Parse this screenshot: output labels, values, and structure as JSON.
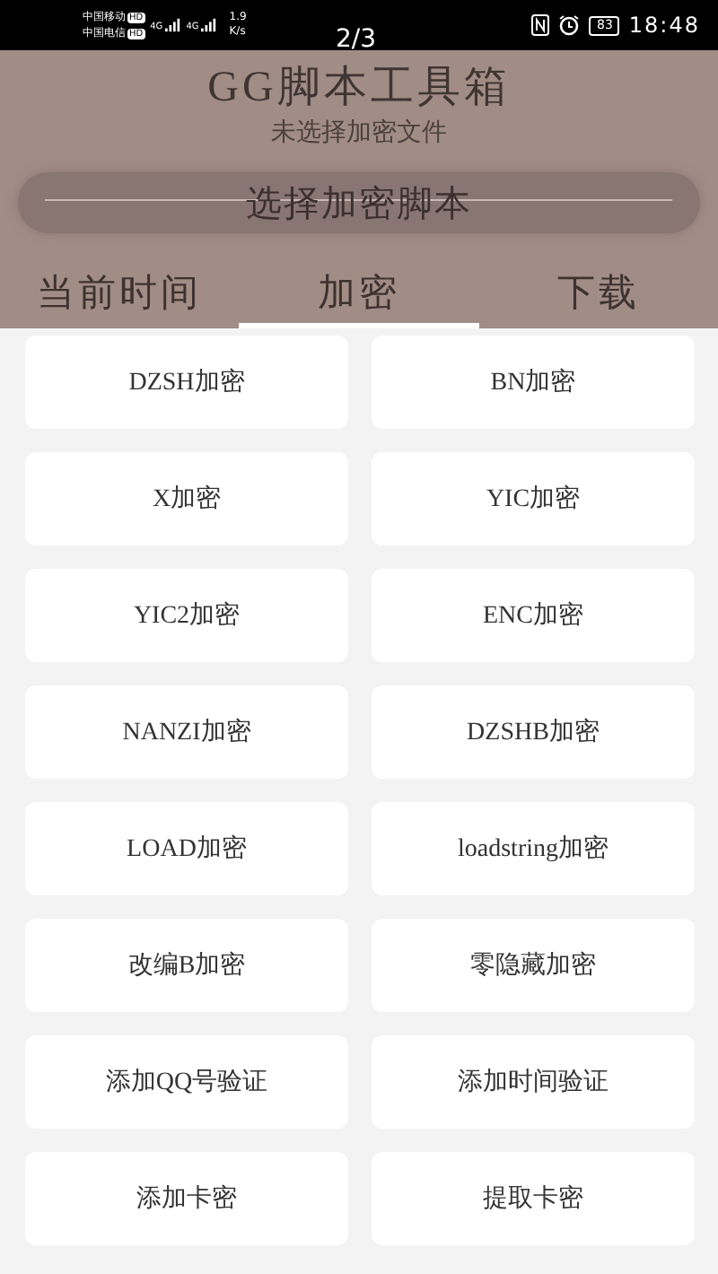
{
  "status_bar": {
    "carriers": [
      {
        "name": "中国移动",
        "badge": "HD",
        "network": "4G"
      },
      {
        "name": "中国电信",
        "badge": "HD",
        "network": "4G"
      }
    ],
    "speed": "1.9",
    "speed_unit": "K/s",
    "battery": "83",
    "time": "18:48"
  },
  "page_indicator": "2/3",
  "header": {
    "title": "GG脚本工具箱",
    "subtitle": "未选择加密文件",
    "select_button": "选择加密脚本"
  },
  "tabs": [
    {
      "label": "当前时间",
      "selected": false
    },
    {
      "label": "加密",
      "selected": true
    },
    {
      "label": "下载",
      "selected": false
    }
  ],
  "actions": [
    {
      "label": "DZSH加密"
    },
    {
      "label": "BN加密"
    },
    {
      "label": "X加密"
    },
    {
      "label": "YIC加密"
    },
    {
      "label": "YIC2加密"
    },
    {
      "label": "ENC加密"
    },
    {
      "label": "NANZI加密"
    },
    {
      "label": "DZSHB加密"
    },
    {
      "label": "LOAD加密"
    },
    {
      "label": "loadstring加密"
    },
    {
      "label": "改编B加密"
    },
    {
      "label": "零隐藏加密"
    },
    {
      "label": "添加QQ号验证"
    },
    {
      "label": "添加时间验证"
    },
    {
      "label": "添加卡密"
    },
    {
      "label": "提取卡密"
    }
  ]
}
